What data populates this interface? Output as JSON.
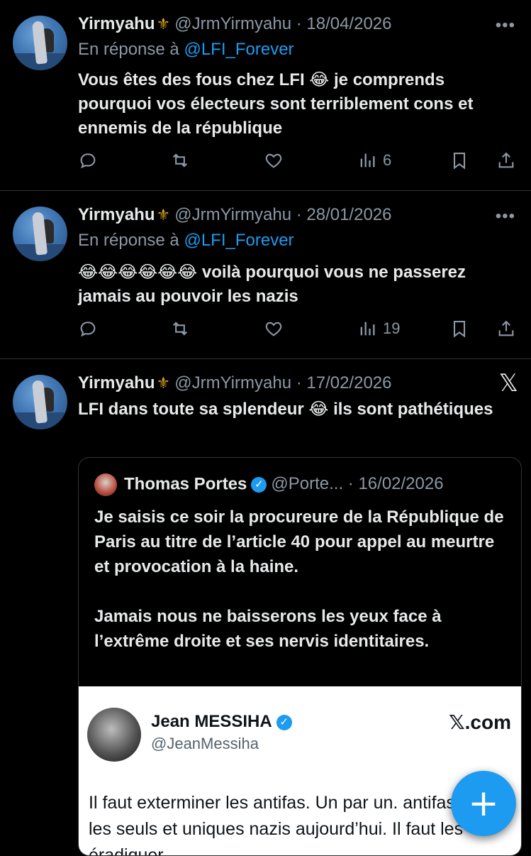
{
  "tweets": [
    {
      "name": "Yirmyahu",
      "handle_date": "@JrmYirmyahu · 18/04/2026",
      "reply_prefix": "En réponse à",
      "reply_mention": "@LFI_Forever",
      "text": "Vous êtes des fous chez LFI 😂 je comprends pourquoi vos électeurs sont terriblement cons et ennemis de la république",
      "views": "6"
    },
    {
      "name": "Yirmyahu",
      "handle_date": "@JrmYirmyahu · 28/01/2026",
      "reply_prefix": "En réponse à",
      "reply_mention": "@LFI_Forever",
      "text": "😂😂😂😂😂😂 voilà pourquoi vous ne passerez jamais au pouvoir les nazis",
      "views": "19"
    },
    {
      "name": "Yirmyahu",
      "handle_date": "@JrmYirmyahu · 17/02/2026",
      "text": "LFI dans toute sa splendeur 😂 ils sont pathétiques",
      "quote": {
        "name": "Thomas Portes",
        "handle_date": "@Porte... · 16/02/2026",
        "text": "Je saisis ce soir la procureure de la République de Paris au titre de l’article 40 pour appel au meurtre et provocation à la haine.\n\nJamais nous ne baisserons les yeux face à l’extrême droite et ses nervis identitaires.",
        "card": {
          "name": "Jean MESSIHA",
          "handle": "@JeanMessiha",
          "brand": "𝕏.com",
          "text": "Il faut exterminer les antifas. Un par un. antifas sont les seuls et uniques nazis aujourd’hui. Il faut les éradiquer."
        }
      }
    }
  ],
  "icons": {
    "more": "more-icon",
    "close": "x-logo-icon",
    "reply": "reply-icon",
    "retweet": "retweet-icon",
    "like": "heart-icon",
    "views": "views-icon",
    "bookmark": "bookmark-icon",
    "share": "share-icon",
    "fab": "compose-icon"
  },
  "colors": {
    "background": "#000000",
    "accent": "#1d9bf0",
    "muted": "#8b98a5",
    "fleur": "#d4a017"
  },
  "fab_symbol": "+"
}
